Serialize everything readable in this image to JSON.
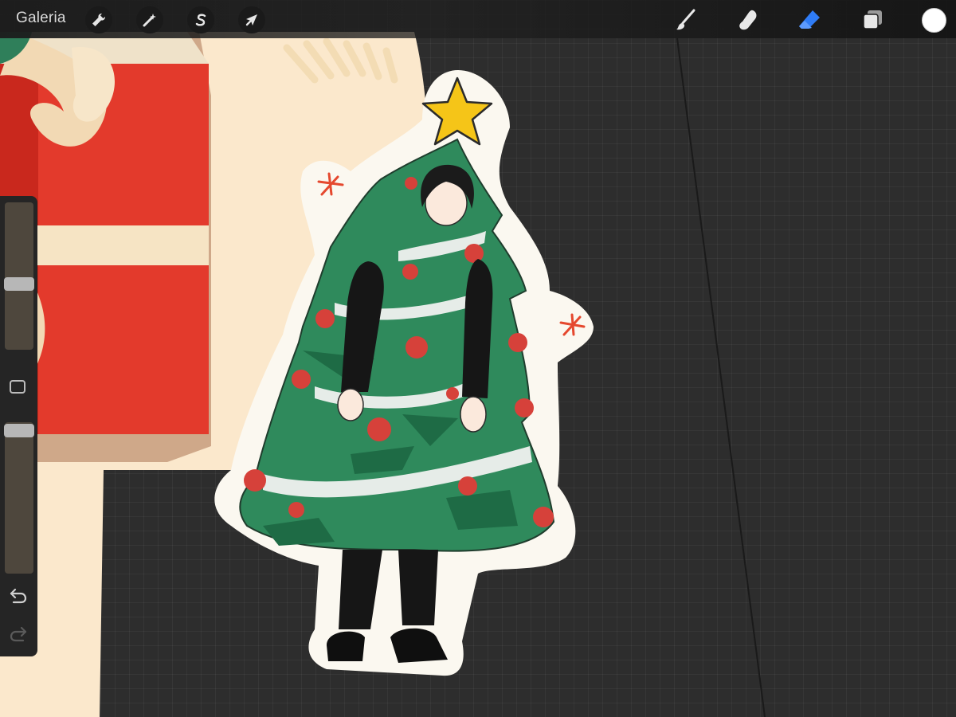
{
  "app": {
    "gallery_label": "Galeria"
  },
  "toolbar": {
    "actions": [
      {
        "name": "actions-wrench",
        "icon": "wrench-icon"
      },
      {
        "name": "adjustments",
        "icon": "magic-wand-icon"
      },
      {
        "name": "selection",
        "icon": "selection-s-icon"
      },
      {
        "name": "transform",
        "icon": "arrow-cursor-icon"
      }
    ],
    "tools": [
      {
        "name": "brush",
        "icon": "brush-icon",
        "active": false
      },
      {
        "name": "smudge",
        "icon": "smudge-finger-icon",
        "active": false
      },
      {
        "name": "eraser",
        "icon": "eraser-icon",
        "active": true
      },
      {
        "name": "layers",
        "icon": "layers-icon",
        "active": false
      }
    ],
    "active_color": "#ffffff",
    "accent_color": "#2f7cf6"
  },
  "sidebar": {
    "brush_size_level": 0.55,
    "opacity_level": 0.95,
    "buttons": [
      "modify-square-icon",
      "undo-icon",
      "redo-icon"
    ]
  }
}
